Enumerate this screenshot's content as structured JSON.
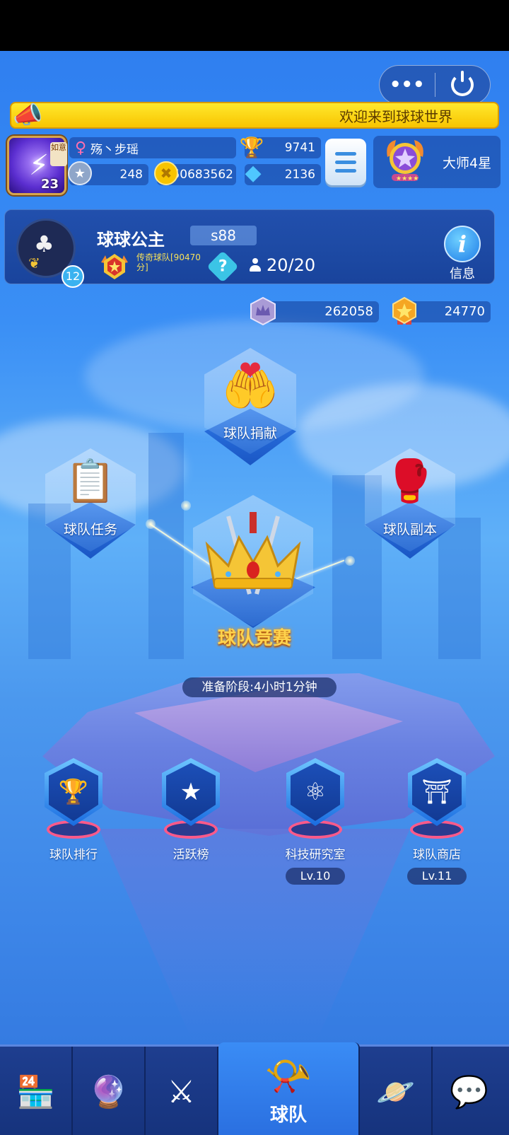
{
  "announcement": "欢迎来到球球世界",
  "player": {
    "name": "殇丶步瑶",
    "level": "23",
    "avatar_tag": "如意",
    "trophies": "9741",
    "stars": "248",
    "coins": "50683562",
    "diamonds": "2136",
    "rank_title": "大师4星"
  },
  "team": {
    "name": "球球公主",
    "server": "s88",
    "level": "12",
    "rank_text": "传奇球队[90470分]",
    "members": "20/20",
    "info_label": "信息"
  },
  "currencies": {
    "crown_points": "262058",
    "medal_points": "24770"
  },
  "buildings": {
    "donate": "球队捐献",
    "task": "球队任务",
    "dungeon": "球队副本",
    "race": "球队竞赛",
    "race_status": "准备阶段:4小时1分钟"
  },
  "features": [
    {
      "label": "球队排行",
      "lv": ""
    },
    {
      "label": "活跃榜",
      "lv": ""
    },
    {
      "label": "科技研究室",
      "lv": "Lv.10"
    },
    {
      "label": "球队商店",
      "lv": "Lv.11"
    }
  ],
  "nav": {
    "active_label": "球队"
  },
  "icons": {
    "more": "more-dots-icon",
    "power": "power-icon",
    "horn": "megaphone-icon"
  },
  "colors": {
    "accent": "#3a8cf5",
    "banner": "#f8c400",
    "gold_text": "#ffd34d"
  }
}
